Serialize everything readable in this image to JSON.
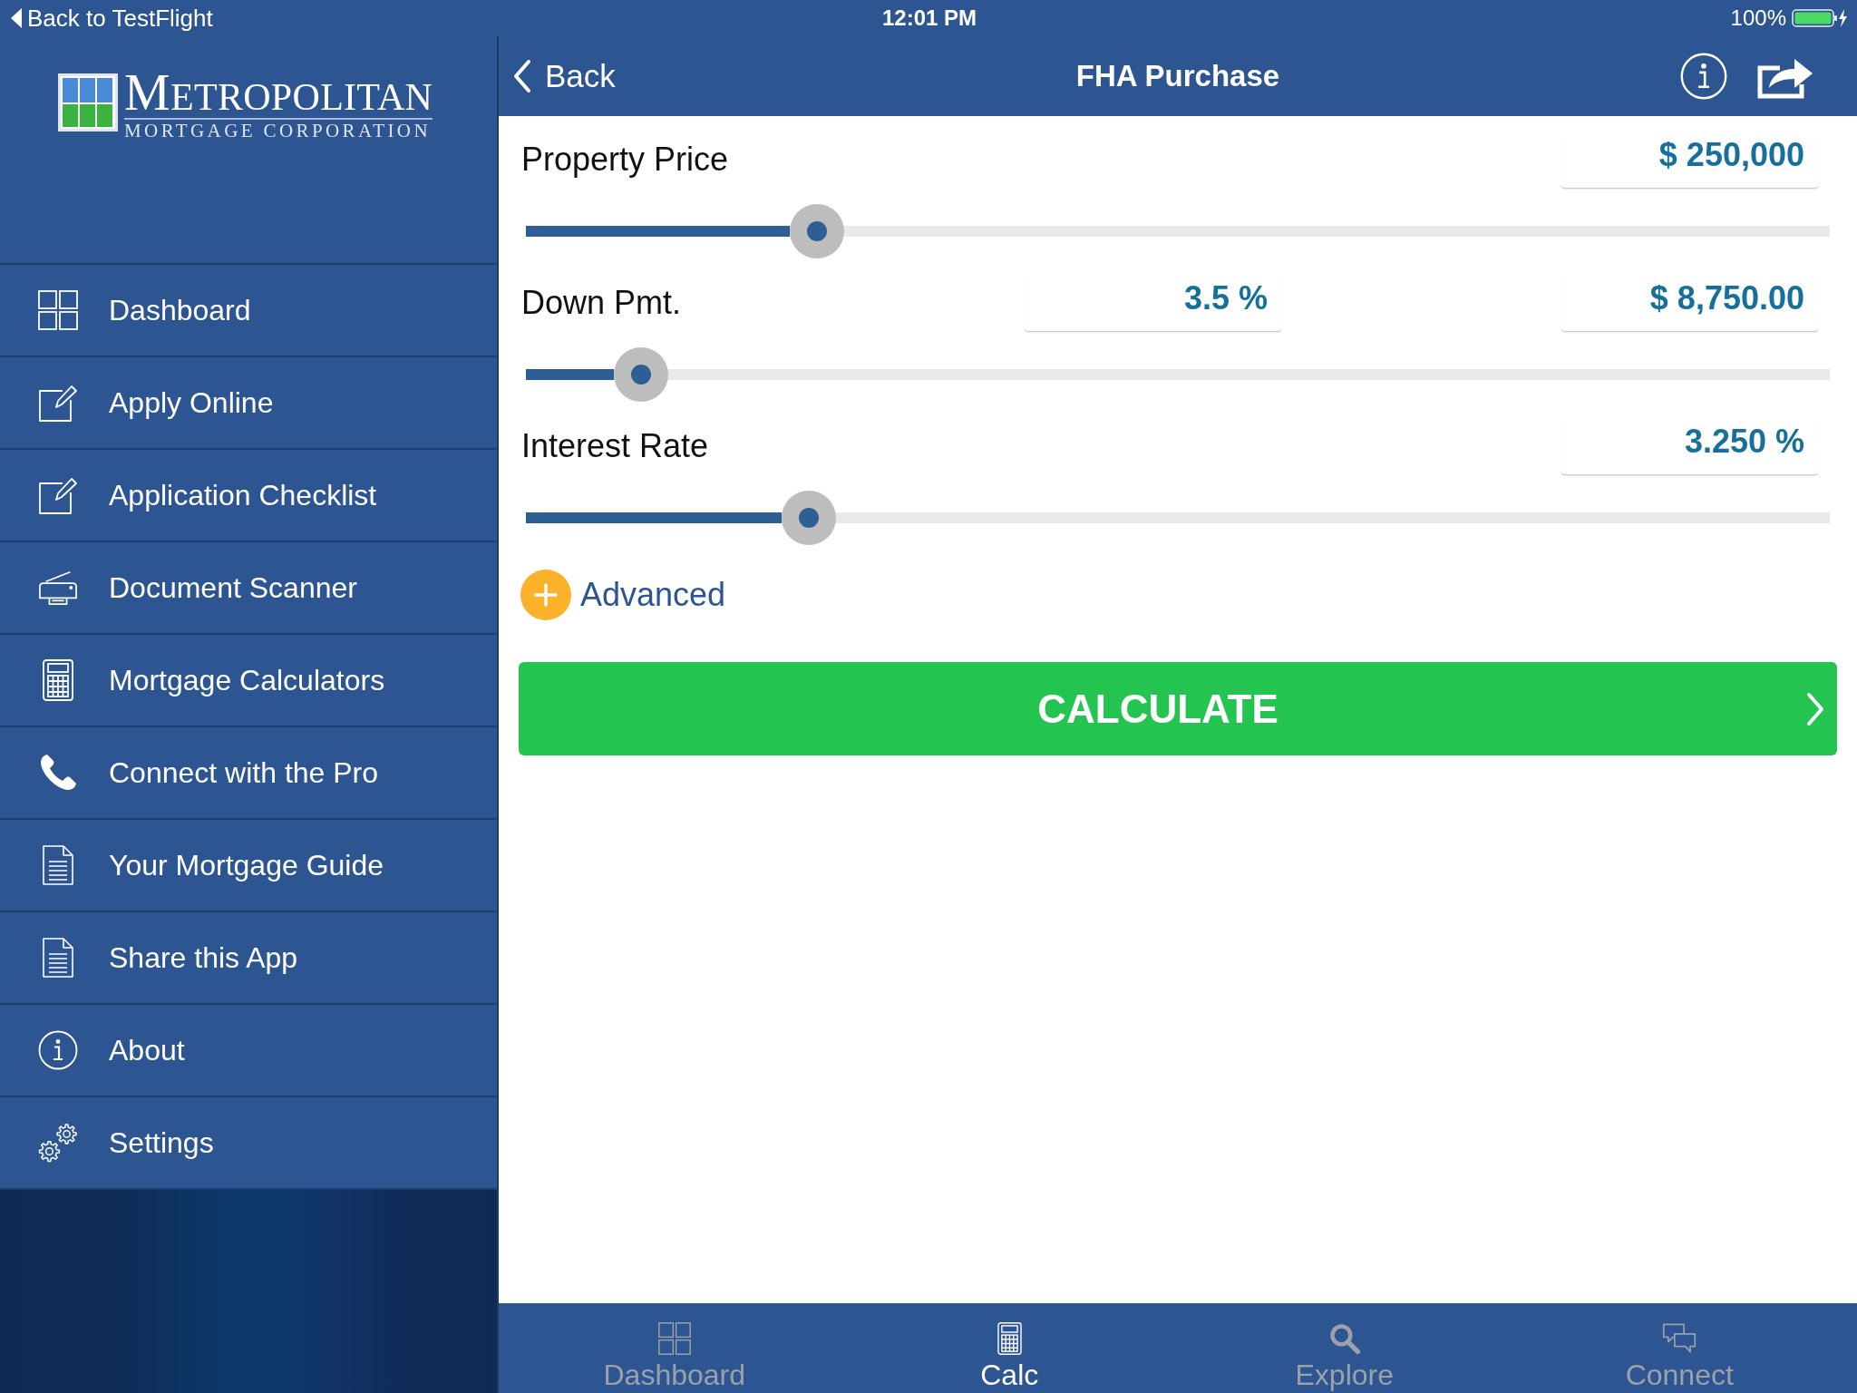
{
  "status_bar": {
    "back_link": "Back to TestFlight",
    "time": "12:01 PM",
    "battery": "100%"
  },
  "sidebar": {
    "logo": {
      "title": "METROPOLITAN",
      "subtitle": "MORTGAGE CORPORATION"
    },
    "items": [
      {
        "label": "Dashboard"
      },
      {
        "label": "Apply Online"
      },
      {
        "label": "Application Checklist"
      },
      {
        "label": "Document Scanner"
      },
      {
        "label": "Mortgage Calculators"
      },
      {
        "label": "Connect with the Pro"
      },
      {
        "label": "Your Mortgage Guide"
      },
      {
        "label": "Share this App"
      },
      {
        "label": "About"
      },
      {
        "label": "Settings"
      }
    ]
  },
  "nav_bar": {
    "back": "Back",
    "title": "FHA Purchase"
  },
  "calculator": {
    "rows": [
      {
        "label": "Property Price",
        "fields": [
          "$ 250,000"
        ],
        "level": 0.223
      },
      {
        "label": "Down Pmt.",
        "fields": [
          "3.5 %",
          "$ 8,750.00"
        ],
        "level": 0.088
      },
      {
        "label": "Interest Rate",
        "fields": [
          "3.250 %"
        ],
        "level": 0.217
      }
    ],
    "advanced": "Advanced",
    "calculate": "CALCULATE"
  },
  "tab_bar": [
    {
      "label": "Dashboard",
      "selected": false
    },
    {
      "label": "Calc",
      "selected": true
    },
    {
      "label": "Explore",
      "selected": false
    },
    {
      "label": "Connect",
      "selected": false
    }
  ]
}
